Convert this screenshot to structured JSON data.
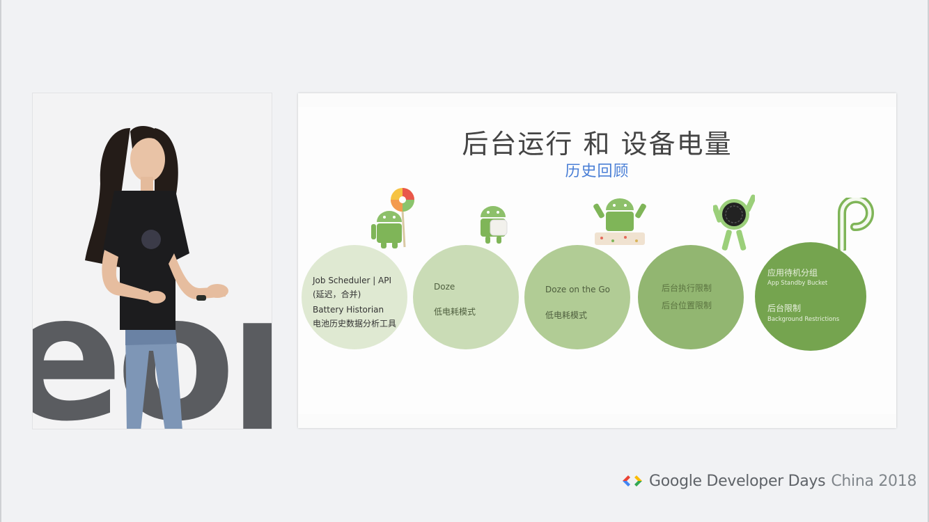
{
  "slide": {
    "title": "后台运行 和 设备电量",
    "subtitle": "历史回顾",
    "circles": [
      {
        "lines": [
          "Job Scheduler  | API",
          "(延迟，合并)",
          "Battery Historian",
          "电池历史数据分析工具"
        ],
        "mascot": "android-lollipop-icon"
      },
      {
        "lines": [
          "Doze",
          "低电耗模式"
        ],
        "mascot": "android-marshmallow-icon"
      },
      {
        "lines": [
          "Doze on the Go",
          "低电耗模式"
        ],
        "mascot": "android-nougat-icon"
      },
      {
        "lines": [
          "后台执行限制",
          "后台位置限制"
        ],
        "mascot": "android-oreo-icon"
      },
      {
        "lines": [
          "应用待机分组",
          "App Standby Bucket",
          "后台限制",
          "Background Restrictions"
        ],
        "mascot": "android-p-logo-icon"
      }
    ]
  },
  "speaker_panel": {
    "backdrop_text": "eop"
  },
  "branding": {
    "name": "Google Developer Days",
    "event": "China 2018",
    "logo": "google-developers-logo-icon",
    "colors": {
      "red": "#ea4335",
      "blue": "#4285f4",
      "green": "#34a853",
      "yellow": "#fbbc05"
    }
  }
}
